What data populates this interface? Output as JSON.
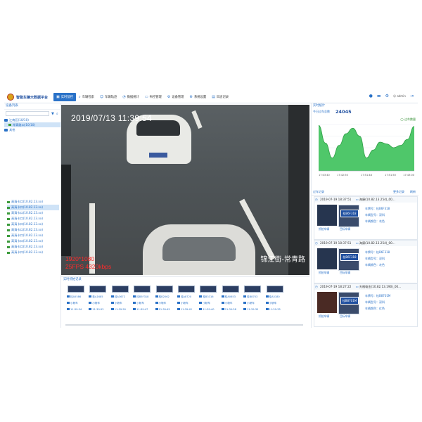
{
  "app": {
    "title": "智能车辆大数据平台"
  },
  "nav": {
    "items": [
      {
        "label": "实时监控",
        "icon": "monitor-icon",
        "active": true
      },
      {
        "label": "车辆检索",
        "icon": "search-icon",
        "active": false
      },
      {
        "label": "车辆轨迹",
        "icon": "person-icon",
        "active": false
      },
      {
        "label": "数据统计",
        "icon": "chart-icon",
        "active": false
      },
      {
        "label": "布控管理",
        "icon": "car-icon",
        "active": false
      },
      {
        "label": "设备管理",
        "icon": "gear-icon",
        "active": false
      },
      {
        "label": "系统设置",
        "icon": "settings-icon",
        "active": false
      },
      {
        "label": "日志记录",
        "icon": "log-icon",
        "active": false
      }
    ],
    "user_label": "admin"
  },
  "left": {
    "header": "设备列表",
    "search_placeholder": "",
    "tree": [
      {
        "label": "江南区(10/10)"
      },
      {
        "label": "常青路口(10/10)"
      },
      {
        "label": "其他"
      }
    ],
    "cameras": [
      "高清卡口(10.82.13.xx)",
      "高清卡口(10.82.13.xx)",
      "高清卡口(10.82.13.xx)",
      "高清卡口(10.82.13.xx)",
      "高清卡口(10.82.13.xx)",
      "高清卡口(10.82.13.xx)",
      "高清卡口(10.82.13.xx)",
      "高清卡口(10.82.13.xx)",
      "高清卡口(10.82.13.xx)",
      "高清卡口(10.82.13.xx)"
    ]
  },
  "video": {
    "timestamp": "2019/07/13 11:39:54",
    "resolution": "1920*1080",
    "fps": "25FPS 4320kbps",
    "location": "锦江街-常青路"
  },
  "plates": {
    "header": "实时抓拍记录",
    "items": [
      {
        "plate": "桂A5586",
        "type": "小轿车",
        "time": "11:39:54"
      },
      {
        "plate": "桂A1685",
        "type": "小轿车",
        "time": "11:39:52"
      },
      {
        "plate": "桂A3672",
        "type": "小轿车",
        "time": "11:39:50"
      },
      {
        "plate": "桂B5F318",
        "type": "小轿车",
        "time": "11:39:47"
      },
      {
        "plate": "桂B2062",
        "type": "小轿车",
        "time": "11:39:45"
      },
      {
        "plate": "桂A8720",
        "type": "小轿车",
        "time": "11:39:42"
      },
      {
        "plate": "桂B3316",
        "type": "小轿车",
        "time": "11:39:40"
      },
      {
        "plate": "桂A0653",
        "type": "小轿车",
        "time": "11:39:38"
      },
      {
        "plate": "桂B8703",
        "type": "小轿车",
        "time": "11:39:35"
      },
      {
        "plate": "桂A5180",
        "type": "小轿车",
        "time": "11:39:33"
      }
    ]
  },
  "right": {
    "header": "实时统计",
    "stat_label": "今日过车总数",
    "stat_value": "24045",
    "legend_label": "过车数量",
    "list_header": "过车记录",
    "list_btn_1": "更多记录",
    "list_btn_2": "刷新",
    "records": [
      {
        "time": "2019-07-19 18:37:51",
        "camera": "海康(10.82.13.254)_00...",
        "plate_label": "车牌号：",
        "plate": "桂B6F318",
        "color_label": "车辆颜色：",
        "color": "灰色",
        "type_label": "车辆型号：",
        "type": "深科",
        "cap1": "抓拍车辆",
        "cap2": "目标车辆",
        "zoom": "桂B6F318"
      },
      {
        "time": "2019-07-19 18:37:51",
        "camera": "海康(10.82.13.254)_00...",
        "plate_label": "车牌号：",
        "plate": "桂B6F318",
        "color_label": "车辆颜色：",
        "color": "灰色",
        "type_label": "车辆型号：",
        "type": "深科",
        "cap1": "抓拍车辆",
        "cap2": "目标车辆",
        "zoom": "桂B6F318"
      },
      {
        "time": "2019-07-19 18:27:22",
        "camera": "天格电金(10.82.13.190)_00...",
        "plate_label": "车牌号：",
        "plate": "桂B8701M",
        "color_label": "车辆颜色：",
        "color": "红色",
        "type_label": "车辆型号：",
        "type": "深科",
        "cap1": "抓拍车辆",
        "cap2": "目标车辆",
        "zoom": "桂B8701M"
      }
    ]
  },
  "chart_data": {
    "type": "area",
    "x": [
      "17:03:40",
      "17:42:50",
      "17:51:48",
      "17:51:50",
      "17:43:00"
    ],
    "xlabel": "",
    "ylabel": "",
    "series": [
      {
        "name": "过车数量",
        "values": [
          98,
          60,
          28,
          55,
          80,
          92,
          75,
          28,
          45,
          62,
          58,
          50,
          55,
          68,
          96
        ]
      }
    ],
    "ylim": [
      0,
      100
    ],
    "colors": {
      "fill": "#4fc76a",
      "line": "#2f9e45"
    },
    "grid": true
  }
}
